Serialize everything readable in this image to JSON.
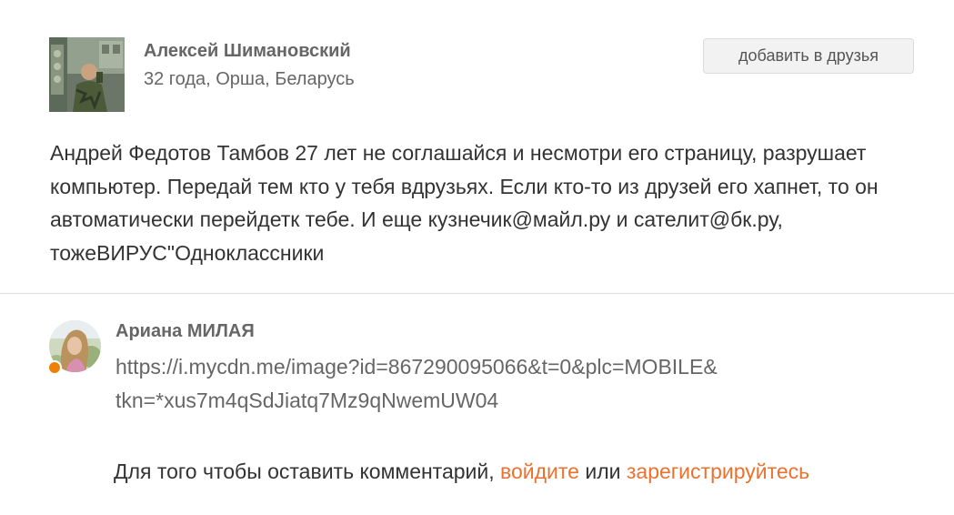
{
  "post": {
    "author_name": "Алексей Шимановский",
    "author_meta": "32 года, Орша, Беларусь",
    "add_friend_label": "добавить в друзья",
    "text": "Андрей Федотов Тамбов 27 лет не соглашайся и несмотри его страницу, разрушает компьютер. Передай тем кто у тебя вдрузьях. Если кто-то из друзей его хапнет, то он автоматически перейдетк тебе. И еще кузнечик@майл.ру и сателит@бк.ру, тожеВИРУС\"Одноклассники"
  },
  "comment": {
    "author_name": "Ариана МИЛАЯ",
    "text_line1": "https://i.mycdn.me/image?id=867290095066&t=0&plc=MOBILE&",
    "text_line2": "tkn=*xus7m4qSdJiatq7Mz9qNwemUW04",
    "online": true
  },
  "login_prompt": {
    "prefix": "Для того чтобы оставить комментарий, ",
    "login_link": "войдите",
    "middle": " или ",
    "register_link": "зарегистрируйтесь"
  },
  "colors": {
    "link": "#eb722e",
    "online_dot": "#ee8208",
    "divider": "#dddddd"
  }
}
